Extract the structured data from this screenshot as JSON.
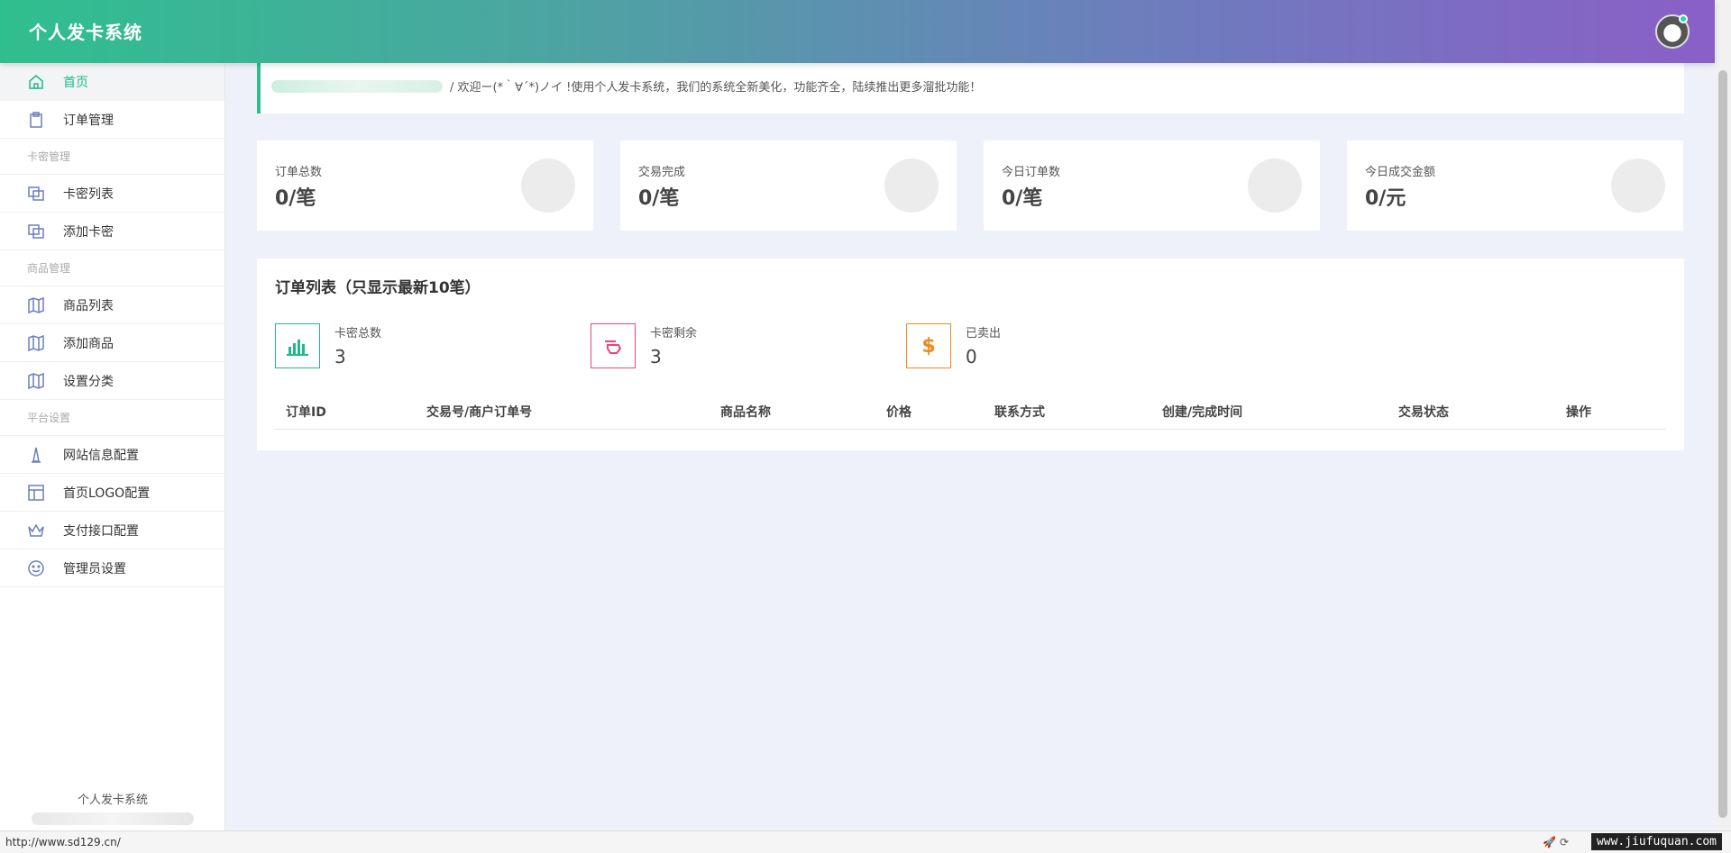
{
  "header": {
    "brand": "个人发卡系统"
  },
  "sidebar": {
    "items": [
      {
        "type": "item",
        "label": "首页",
        "icon": "home-icon",
        "active": true
      },
      {
        "type": "item",
        "label": "订单管理",
        "icon": "clipboard-icon"
      },
      {
        "type": "group",
        "label": "卡密管理"
      },
      {
        "type": "item",
        "label": "卡密列表",
        "icon": "copy-icon"
      },
      {
        "type": "item",
        "label": "添加卡密",
        "icon": "copy-icon"
      },
      {
        "type": "group",
        "label": "商品管理"
      },
      {
        "type": "item",
        "label": "商品列表",
        "icon": "map-icon"
      },
      {
        "type": "item",
        "label": "添加商品",
        "icon": "map-icon"
      },
      {
        "type": "item",
        "label": "设置分类",
        "icon": "map-icon"
      },
      {
        "type": "group",
        "label": "平台设置"
      },
      {
        "type": "item",
        "label": "网站信息配置",
        "icon": "tower-icon"
      },
      {
        "type": "item",
        "label": "首页LOGO配置",
        "icon": "layout-icon"
      },
      {
        "type": "item",
        "label": "支付接口配置",
        "icon": "crown-icon"
      },
      {
        "type": "item",
        "label": "管理员设置",
        "icon": "smile-icon"
      }
    ],
    "footer": "个人发卡系统"
  },
  "notice": {
    "text": "/ 欢迎ー(*｀∀´*)ノイ !使用个人发卡系统，我们的系统全新美化，功能齐全，陆续推出更多溜批功能！"
  },
  "cards": [
    {
      "label": "订单总数",
      "value": "0/笔"
    },
    {
      "label": "交易完成",
      "value": "0/笔"
    },
    {
      "label": "今日订单数",
      "value": "0/笔"
    },
    {
      "label": "今日成交金额",
      "value": "0/元"
    }
  ],
  "panel": {
    "title": "订单列表（只显示最新10笔）",
    "stats": [
      {
        "label": "卡密总数",
        "value": "3",
        "icon": "bar-chart-icon",
        "color": "#1fb98a"
      },
      {
        "label": "卡密剩余",
        "value": "3",
        "icon": "hand-icon",
        "color": "#e8457a"
      },
      {
        "label": "已卖出",
        "value": "0",
        "icon": "dollar-icon",
        "color": "#f08a1c"
      }
    ],
    "columns": [
      "订单ID",
      "交易号/商户订单号",
      "商品名称",
      "价格",
      "联系方式",
      "创建/完成时间",
      "交易状态",
      "操作"
    ]
  },
  "statusbar": {
    "url": "http://www.sd129.cn/",
    "watermark": "www.jiufuquan.com"
  }
}
